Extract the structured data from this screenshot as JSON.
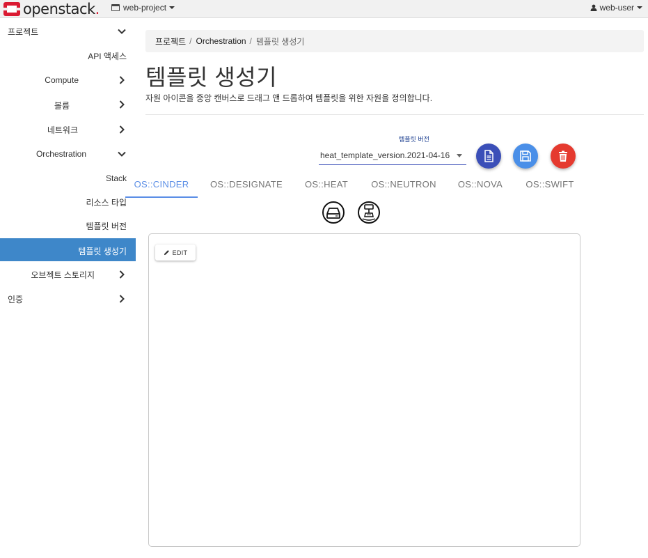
{
  "app": {
    "logo_text": "openstack",
    "logo_dot": ".",
    "project_name": "web-project",
    "user_name": "web-user",
    "brand_color": "#da1a32"
  },
  "sidebar": {
    "active_color": "#3e87c9",
    "items": [
      {
        "label": "프로젝트",
        "chevron": "down"
      },
      {
        "label": "API 액세스"
      },
      {
        "label": "Compute",
        "chevron": "right"
      },
      {
        "label": "볼륨",
        "chevron": "right"
      },
      {
        "label": "네트워크",
        "chevron": "right"
      },
      {
        "label": "Orchestration",
        "chevron": "down"
      },
      {
        "label": "Stack"
      },
      {
        "label": "리소스 타입"
      },
      {
        "label": "템플릿 버전"
      },
      {
        "label": "템플릿 생성기",
        "active": true
      },
      {
        "label": "오브젝트 스토리지",
        "chevron": "right"
      },
      {
        "label": "인증",
        "chevron": "right"
      }
    ]
  },
  "breadcrumb": [
    "프로젝트",
    "Orchestration",
    "템플릿 생성기"
  ],
  "breadcrumb_sep": "/",
  "page": {
    "title": "템플릿 생성기",
    "description": "자원 아이콘을 중앙 캔버스로 드래그 앤 드롭하여 템플릿을 위한 자원을 정의합니다."
  },
  "template_version": {
    "label": "템플릿 버전",
    "selected": "heat_template_version.2021-04-16"
  },
  "actions": [
    {
      "name": "view-template-button",
      "icon": "document-icon",
      "color": "#3b4fb8"
    },
    {
      "name": "save-template-button",
      "icon": "floppy-disk-icon",
      "color": "#4a8fe8"
    },
    {
      "name": "delete-template-button",
      "icon": "trash-icon",
      "color": "#e53a2f"
    }
  ],
  "tabs": [
    {
      "label": "OS::CINDER",
      "active": true
    },
    {
      "label": "OS::DESIGNATE"
    },
    {
      "label": "OS::HEAT"
    },
    {
      "label": "OS::NEUTRON"
    },
    {
      "label": "OS::NOVA"
    },
    {
      "label": "OS::SWIFT"
    }
  ],
  "resource_icons": [
    "volume-drive-icon",
    "volume-attachment-icon"
  ],
  "canvas": {
    "edit_label": "EDIT"
  }
}
